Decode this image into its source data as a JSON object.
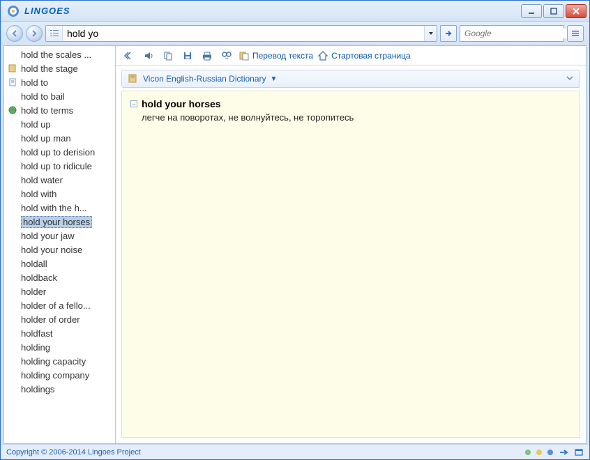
{
  "app": {
    "title": "LINGOES"
  },
  "search": {
    "value": "hold yo",
    "web_placeholder": "Google"
  },
  "toolbar": {
    "translate": "Перевод текста",
    "home": "Стартовая страница"
  },
  "dictionary": {
    "name": "Vicon English-Russian Dictionary"
  },
  "entry": {
    "term": "hold your horses",
    "definition": "легче на поворотах, не волнуйтесь, не торопитесь"
  },
  "wordlist": [
    {
      "text": "hold the scales ...",
      "icon": null
    },
    {
      "text": "hold the stage",
      "icon": "book"
    },
    {
      "text": "hold to",
      "icon": "page"
    },
    {
      "text": "hold to bail",
      "icon": null
    },
    {
      "text": "hold to terms",
      "icon": "globe"
    },
    {
      "text": "hold up",
      "icon": null
    },
    {
      "text": "hold up man",
      "icon": null
    },
    {
      "text": "hold up to derision",
      "icon": null
    },
    {
      "text": "hold up to ridicule",
      "icon": null
    },
    {
      "text": "hold water",
      "icon": null
    },
    {
      "text": "hold with",
      "icon": null
    },
    {
      "text": "hold with the h...",
      "icon": null
    },
    {
      "text": "hold your horses",
      "icon": null,
      "selected": true
    },
    {
      "text": "hold your jaw",
      "icon": null
    },
    {
      "text": "hold your noise",
      "icon": null
    },
    {
      "text": "holdall",
      "icon": null
    },
    {
      "text": "holdback",
      "icon": null
    },
    {
      "text": "holder",
      "icon": null
    },
    {
      "text": "holder of a fello...",
      "icon": null
    },
    {
      "text": "holder of order",
      "icon": null
    },
    {
      "text": "holdfast",
      "icon": null
    },
    {
      "text": "holding",
      "icon": null
    },
    {
      "text": "holding capacity",
      "icon": null
    },
    {
      "text": "holding company",
      "icon": null
    },
    {
      "text": "holdings",
      "icon": null
    }
  ],
  "status": {
    "copyright": "Copyright © 2006-2014 Lingoes Project"
  }
}
